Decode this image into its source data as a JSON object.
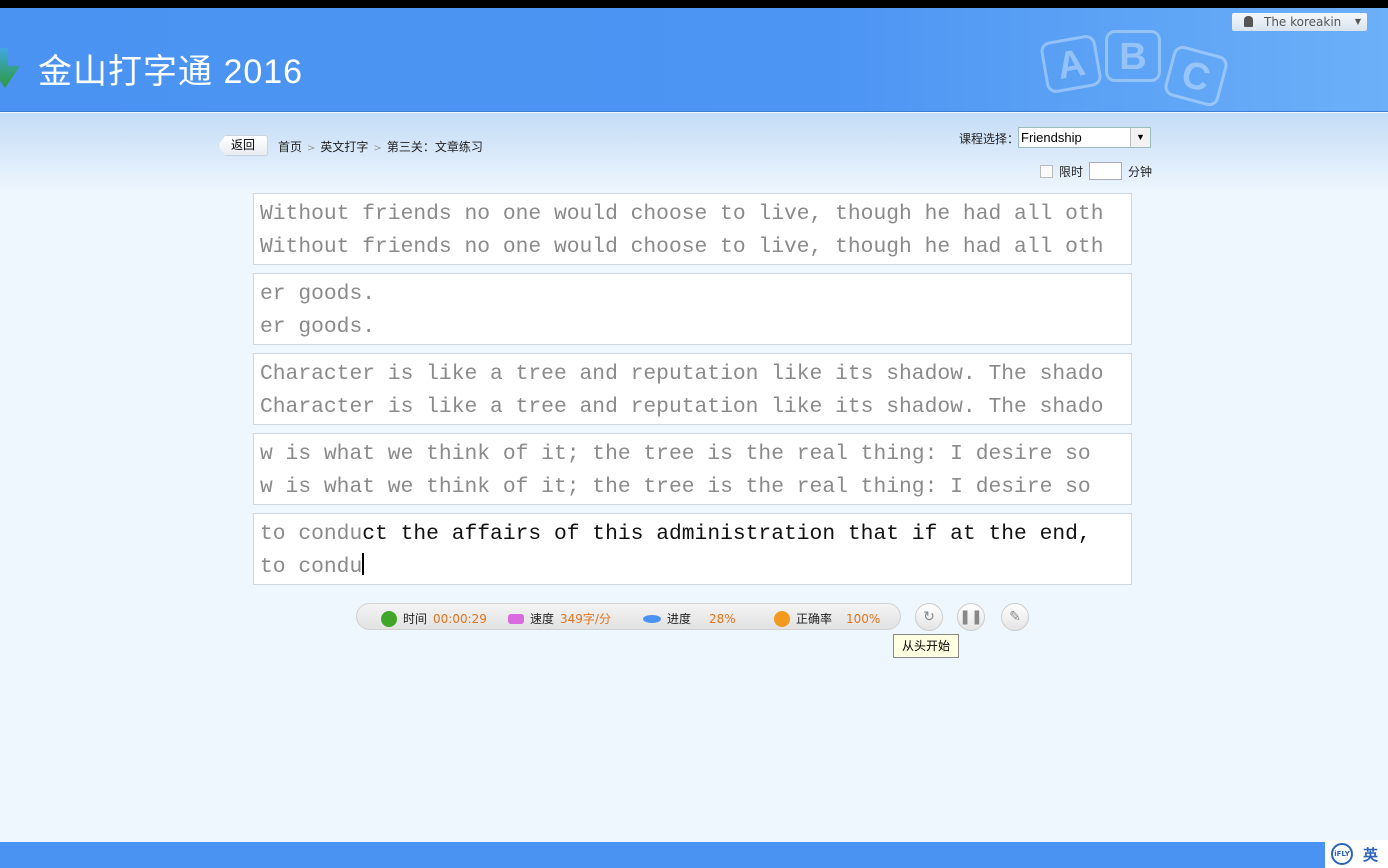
{
  "app": {
    "title": "金山打字通 2016",
    "user": "The koreakin"
  },
  "nav": {
    "back": "返回",
    "breadcrumb": [
      "首页",
      "英文打字",
      "第三关：文章练习"
    ],
    "separator": ">"
  },
  "course": {
    "label": "课程选择：",
    "value": "Friendship"
  },
  "time_limit": {
    "label": "限时",
    "unit": "分钟",
    "value": "",
    "checked": false
  },
  "lines": [
    {
      "source": "Without friends no one would choose to live, though he had all oth",
      "typed": "Without friends no one would choose to live, though he had all oth"
    },
    {
      "source": "er goods.",
      "typed": "er goods."
    },
    {
      "source": "Character is like a tree and reputation like its shadow. The shado",
      "typed": "Character is like a tree and reputation like its shadow. The shado"
    },
    {
      "source": "w is what we think of it; the tree is the real thing: I desire so",
      "typed": "w is what we think of it; the tree is the real thing: I desire so"
    },
    {
      "source_done": "to condu",
      "source_rest": "ct the affairs of this administration that if at the end,",
      "typed": "to condu"
    }
  ],
  "stats": {
    "time_label": "时间",
    "time": "00:00:29",
    "speed_label": "速度",
    "speed": "349字/分",
    "progress_label": "进度",
    "progress": "28%",
    "accuracy_label": "正确率",
    "accuracy": "100%"
  },
  "controls": {
    "restart_tooltip": "从头开始"
  },
  "ime": {
    "logo": "iFLY",
    "mode": "英"
  },
  "colors": {
    "header": "#4a93f2",
    "value": "#e0741c"
  }
}
